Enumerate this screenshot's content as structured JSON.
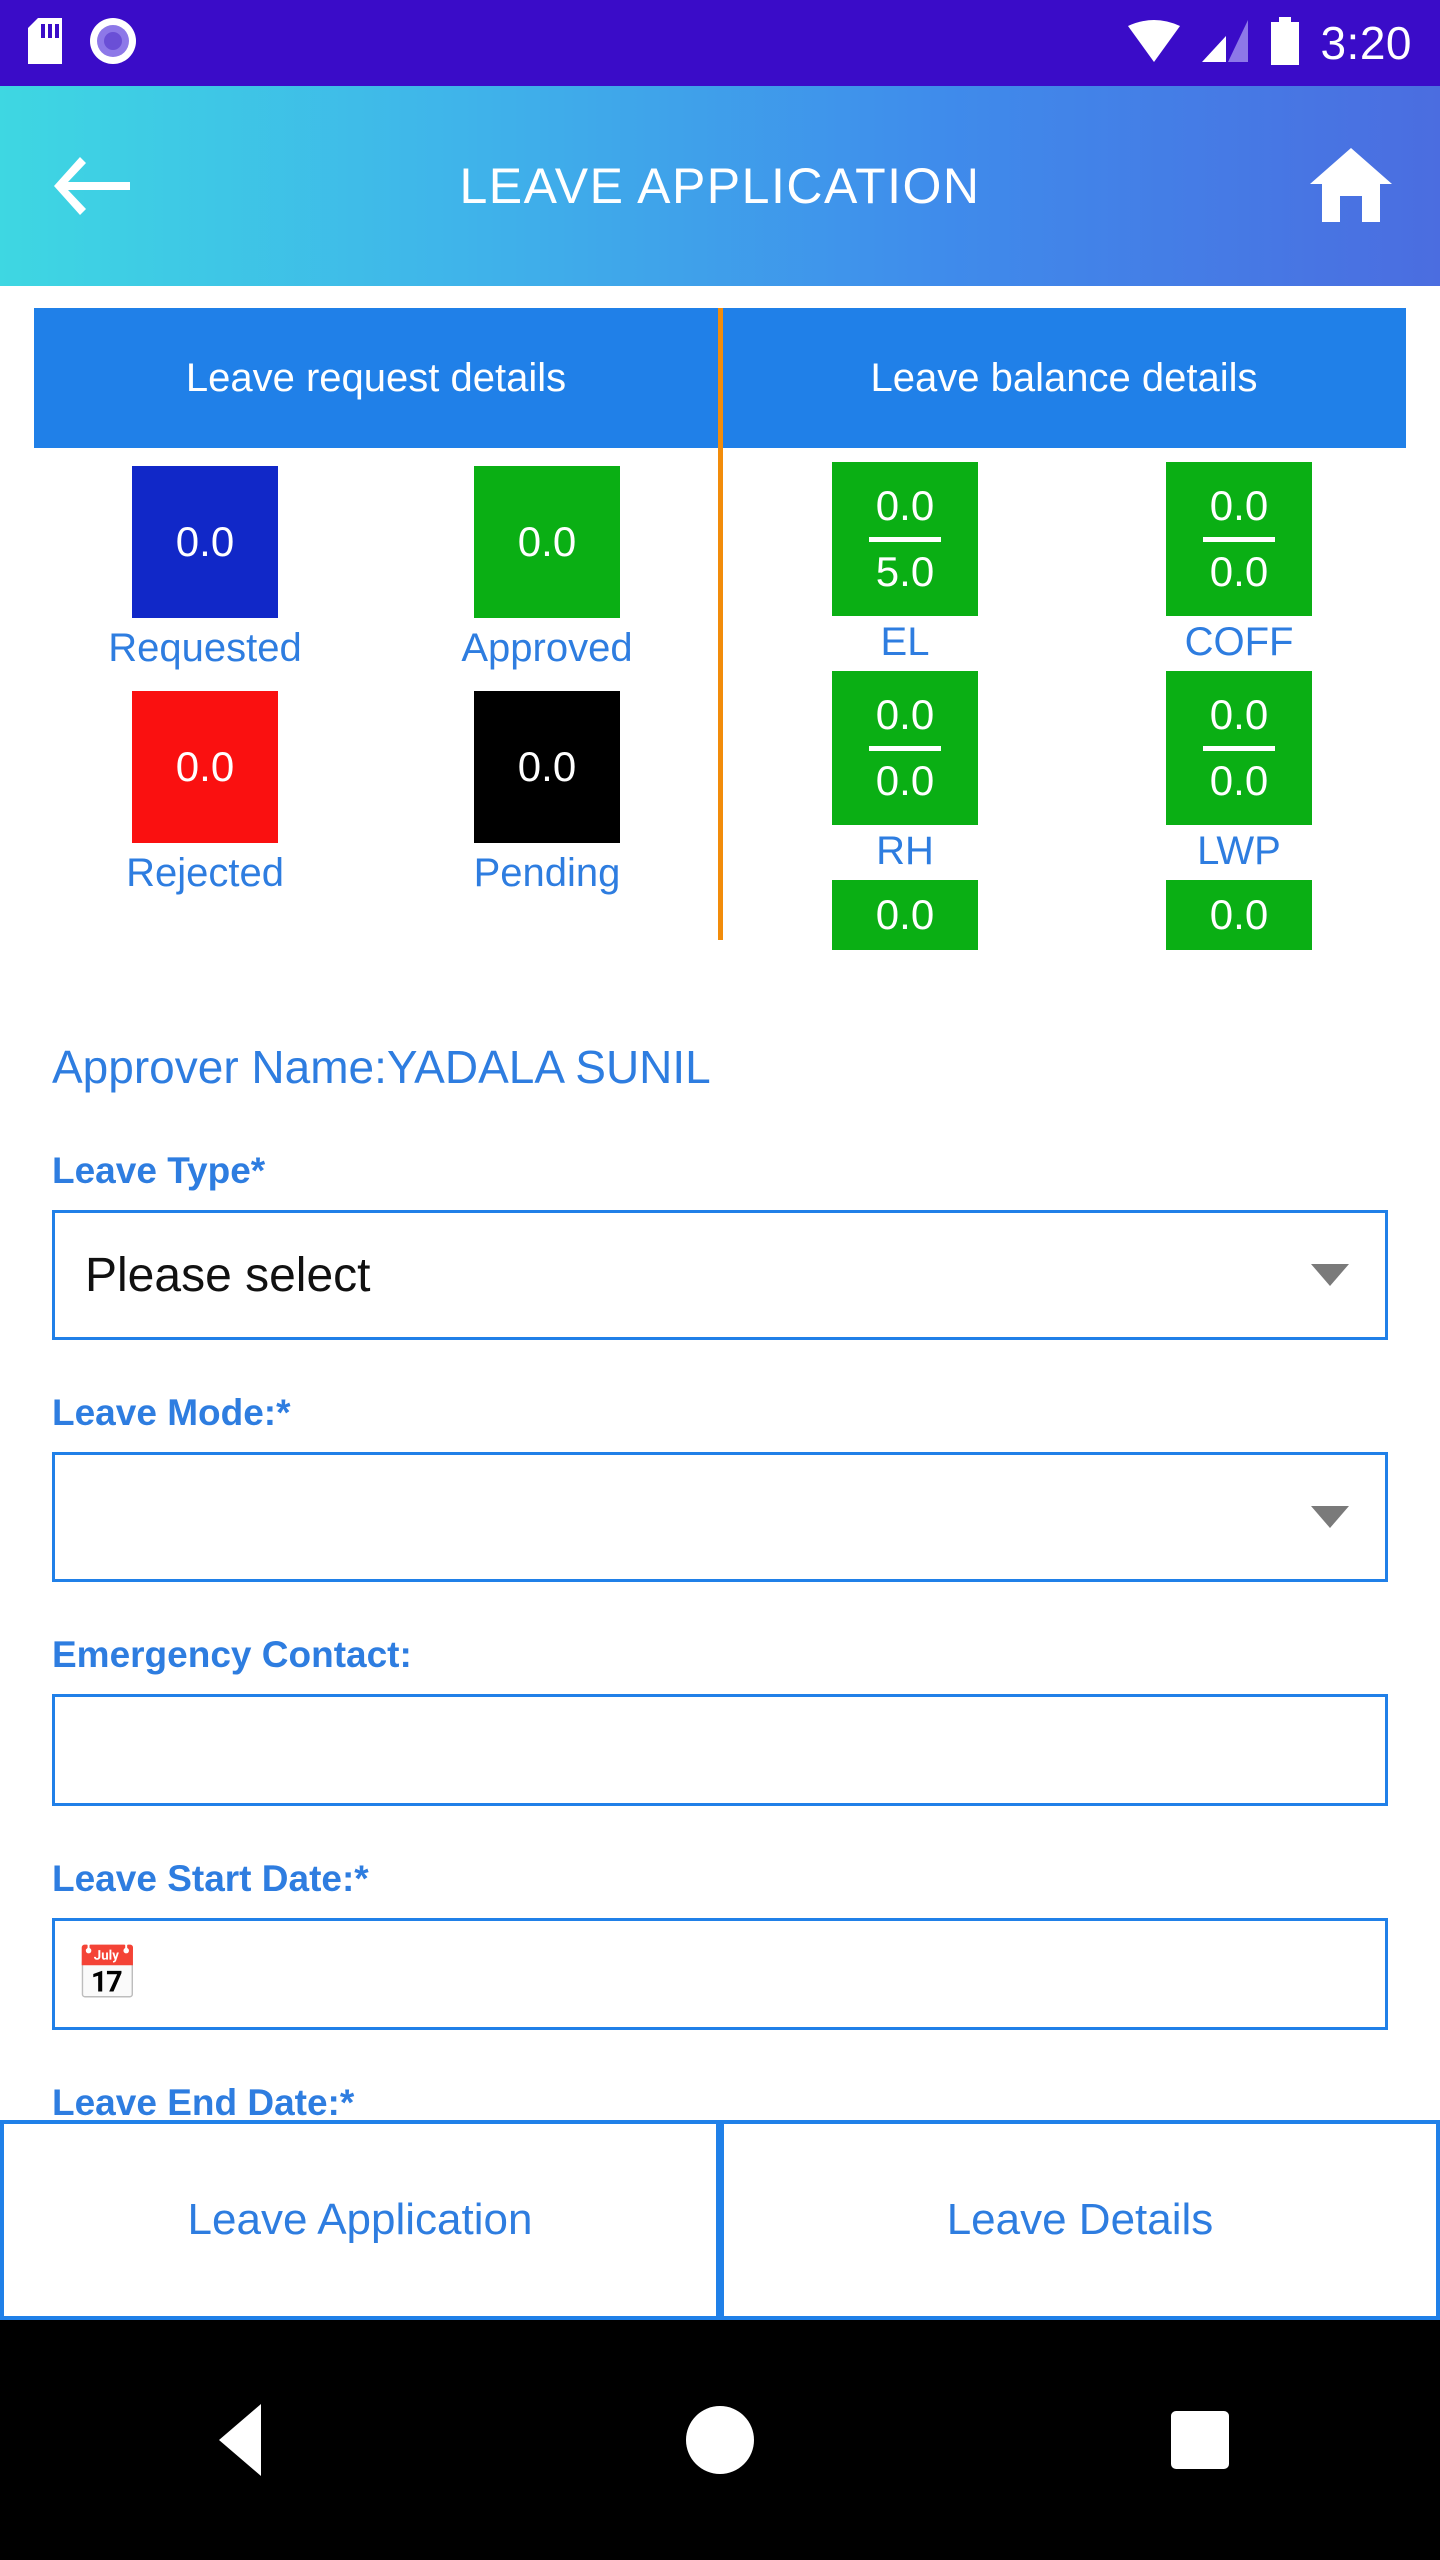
{
  "status_bar": {
    "time": "3:20"
  },
  "app_bar": {
    "title": "LEAVE APPLICATION"
  },
  "summary": {
    "request_header": "Leave request details",
    "balance_header": "Leave balance details",
    "request_stats": [
      {
        "label": "Requested",
        "value": "0.0",
        "color": "#1128C8"
      },
      {
        "label": "Approved",
        "value": "0.0",
        "color": "#0AAF14"
      },
      {
        "label": "Rejected",
        "value": "0.0",
        "color": "#FA1010"
      },
      {
        "label": "Pending",
        "value": "0.0",
        "color": "#000000"
      }
    ],
    "balances": [
      {
        "label": "EL",
        "used": "0.0",
        "total": "5.0"
      },
      {
        "label": "COFF",
        "used": "0.0",
        "total": "0.0"
      },
      {
        "label": "RH",
        "used": "0.0",
        "total": "0.0"
      },
      {
        "label": "LWP",
        "used": "0.0",
        "total": "0.0"
      },
      {
        "label": "",
        "used": "0.0",
        "total": ""
      },
      {
        "label": "",
        "used": "0.0",
        "total": ""
      }
    ]
  },
  "form": {
    "approver": "Approver Name:YADALA SUNIL",
    "fields": [
      {
        "label": "Leave Type*",
        "value": "Please select",
        "type": "select"
      },
      {
        "label": "Leave Mode:*",
        "value": "",
        "type": "select"
      },
      {
        "label": "Emergency Contact:",
        "value": "",
        "type": "text"
      },
      {
        "label": "Leave Start Date:*",
        "value": "",
        "icon_glyph": "📅",
        "type": "date"
      },
      {
        "label": "Leave End Date:*",
        "value": "",
        "icon_glyph": "📅",
        "type": "date"
      }
    ]
  },
  "bottom_tabs": [
    "Leave Application",
    "Leave Details"
  ],
  "colors": {
    "status_bar": "#3A0CC8",
    "app_bar_gradient_start": "#3ED7E2",
    "app_bar_gradient_end": "#4B6DE0",
    "header_blue": "#2080E8",
    "accent_blue": "#2E7DE0",
    "green": "#0AAF14",
    "red": "#FA1010",
    "deep_blue": "#1128C8",
    "divider_orange": "#F28C0A",
    "nav_bar": "#000000"
  }
}
